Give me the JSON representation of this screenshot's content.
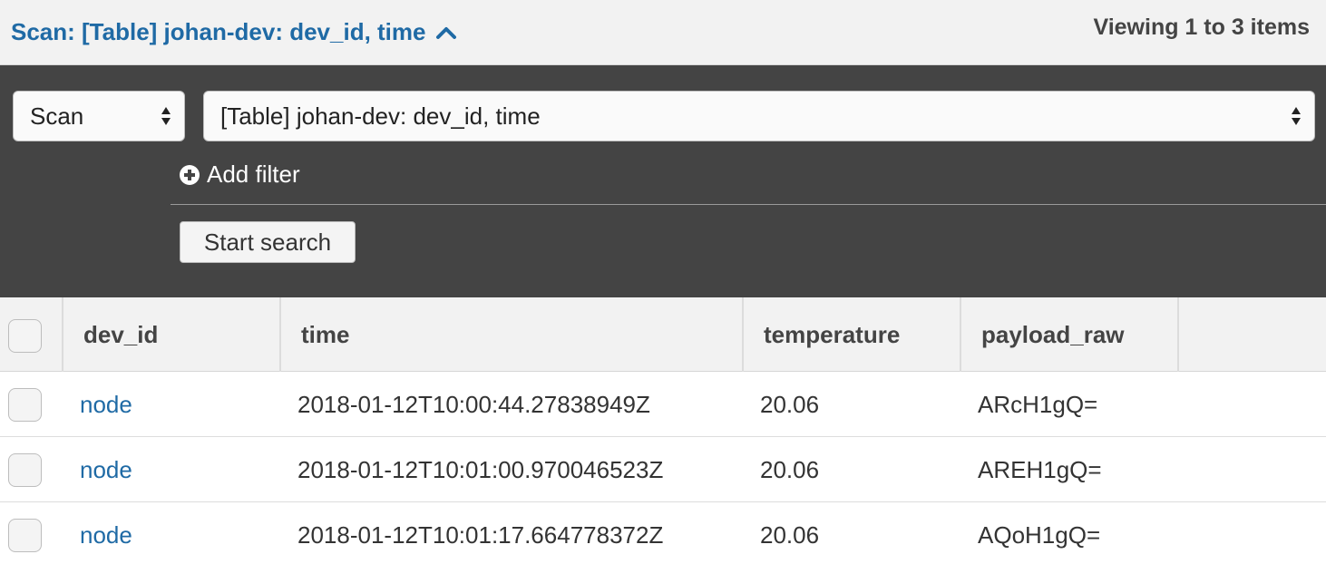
{
  "header": {
    "scan_title": "Scan: [Table] johan-dev: dev_id, time",
    "viewing": "Viewing 1 to 3 items"
  },
  "search_panel": {
    "operation_select": {
      "value": "Scan",
      "options": [
        "Scan"
      ]
    },
    "table_select": {
      "value": "[Table] johan-dev: dev_id, time"
    },
    "add_filter_label": "Add filter",
    "start_search_label": "Start search"
  },
  "table": {
    "columns": [
      "dev_id",
      "time",
      "temperature",
      "payload_raw"
    ],
    "rows": [
      {
        "dev_id": "node",
        "time": "2018-01-12T10:00:44.27838949Z",
        "temperature": "20.06",
        "payload_raw": "ARcH1gQ="
      },
      {
        "dev_id": "node",
        "time": "2018-01-12T10:01:00.970046523Z",
        "temperature": "20.06",
        "payload_raw": "AREH1gQ="
      },
      {
        "dev_id": "node",
        "time": "2018-01-12T10:01:17.664778372Z",
        "temperature": "20.06",
        "payload_raw": "AQoH1gQ="
      }
    ]
  },
  "colors": {
    "link": "#1f6aa5",
    "panel": "#444444",
    "header_bg": "#f2f2f2"
  },
  "icons": [
    "chevron-up-icon",
    "select-arrows-icon",
    "plus-circle-icon",
    "checkbox-icon"
  ]
}
